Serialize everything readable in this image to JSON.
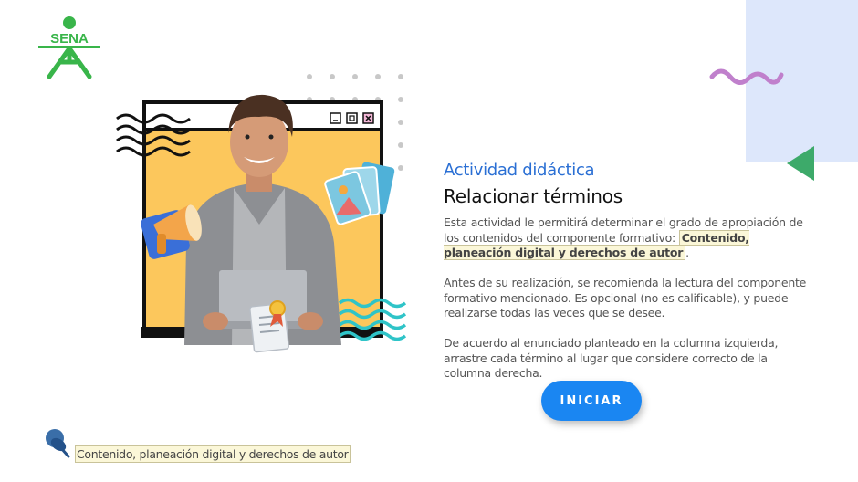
{
  "brand": {
    "logo_text": "SENA",
    "logo_color": "#39b54a"
  },
  "colors": {
    "accent_blue": "#1a86f2",
    "title_blue": "#2a6fd4",
    "panel_blue": "#dde7fb",
    "squiggle_purple": "#c080cc",
    "triangle_green": "#3daa6a",
    "illustration_yellow": "#fcc75c"
  },
  "content": {
    "title": "Actividad didáctica",
    "subtitle": "Relacionar términos",
    "p1_text": "Esta actividad le permitirá determinar el grado de apropiación de los contenidos del componente formativo: ",
    "p1_highlight": "Contenido, planeación digital y derechos de autor",
    "p1_end": ".",
    "p2": "Antes de su realización, se recomienda la lectura del componente formativo mencionado.  Es opcional (no es calificable), y puede realizarse todas las veces que se desee.",
    "p3": "De acuerdo al enunciado planteado en la columna izquierda, arrastre cada término al lugar que considere correcto de la columna derecha."
  },
  "button": {
    "label": "INICIAR"
  },
  "footer": {
    "component_label": "Contenido, planeación digital y derechos de autor"
  },
  "icons": [
    "sena-logo",
    "squiggle-decoration",
    "triangle-play-icon",
    "pushpin-icon",
    "megaphone-icon",
    "photo-cards-icon",
    "certificate-icon",
    "window-minimize-icon",
    "window-maximize-icon",
    "window-close-icon"
  ]
}
